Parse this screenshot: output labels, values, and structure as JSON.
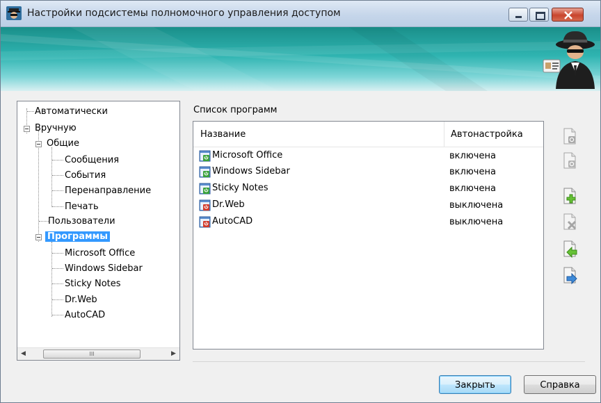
{
  "window": {
    "title": "Настройки подсистемы полномочного управления доступом"
  },
  "tree": {
    "items": [
      {
        "label": "Автоматически"
      },
      {
        "label": "Вручную"
      },
      {
        "label": "Общие"
      },
      {
        "label": "Сообщения"
      },
      {
        "label": "События"
      },
      {
        "label": "Перенаправление"
      },
      {
        "label": "Печать"
      },
      {
        "label": "Пользователи"
      },
      {
        "label": "Программы",
        "selected": true
      },
      {
        "label": "Microsoft Office"
      },
      {
        "label": "Windows Sidebar"
      },
      {
        "label": "Sticky Notes"
      },
      {
        "label": "Dr.Web"
      },
      {
        "label": "AutoCAD"
      }
    ],
    "scroll_thumb": "III"
  },
  "program_list": {
    "label": "Список программ",
    "columns": {
      "name": "Название",
      "autoconfig": "Автонастройка"
    },
    "rows": [
      {
        "name": "Microsoft Office",
        "status": "включена",
        "icon": "program-enabled-icon"
      },
      {
        "name": "Windows Sidebar",
        "status": "включена",
        "icon": "program-enabled-icon"
      },
      {
        "name": "Sticky Notes",
        "status": "включена",
        "icon": "program-enabled-icon"
      },
      {
        "name": "Dr.Web",
        "status": "выключена",
        "icon": "program-disabled-icon"
      },
      {
        "name": "AutoCAD",
        "status": "выключена",
        "icon": "program-disabled-icon"
      }
    ]
  },
  "side_actions": [
    {
      "icon": "document-enable-icon"
    },
    {
      "icon": "document-disable-icon"
    },
    {
      "icon": "add-document-icon"
    },
    {
      "icon": "delete-document-icon"
    },
    {
      "icon": "import-document-icon"
    },
    {
      "icon": "export-document-icon"
    }
  ],
  "buttons": {
    "close": "Закрыть",
    "help": "Справка"
  },
  "colors": {
    "selection": "#3399ff",
    "enabled_icon": "#3aa23a",
    "disabled_icon": "#d23a2a",
    "banner": "#2fb4b1"
  }
}
